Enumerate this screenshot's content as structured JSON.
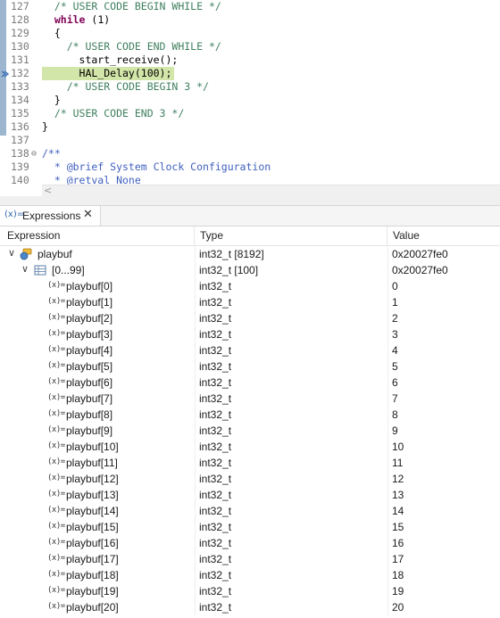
{
  "editor": {
    "lines": [
      {
        "num": "127",
        "parts": [
          {
            "t": "  ",
            "c": ""
          },
          {
            "t": "/* USER CODE BEGIN WHILE */",
            "c": "c-comment"
          }
        ]
      },
      {
        "num": "128",
        "parts": [
          {
            "t": "  ",
            "c": ""
          },
          {
            "t": "while",
            "c": "c-kw"
          },
          {
            "t": " (1)",
            "c": ""
          }
        ]
      },
      {
        "num": "129",
        "parts": [
          {
            "t": "  {",
            "c": ""
          }
        ]
      },
      {
        "num": "130",
        "parts": [
          {
            "t": "    ",
            "c": ""
          },
          {
            "t": "/* USER CODE END WHILE */",
            "c": "c-comment"
          }
        ]
      },
      {
        "num": "131",
        "parts": [
          {
            "t": "      start_receive();",
            "c": ""
          }
        ]
      },
      {
        "num": "132",
        "parts": [
          {
            "t": "      HAL_Delay(100);",
            "c": ""
          }
        ],
        "highlight": true,
        "exec": true
      },
      {
        "num": "133",
        "parts": [
          {
            "t": "    ",
            "c": ""
          },
          {
            "t": "/* USER CODE BEGIN 3 */",
            "c": "c-comment"
          }
        ]
      },
      {
        "num": "134",
        "parts": [
          {
            "t": "  }",
            "c": ""
          }
        ]
      },
      {
        "num": "135",
        "parts": [
          {
            "t": "  ",
            "c": ""
          },
          {
            "t": "/* USER CODE END 3 */",
            "c": "c-comment"
          }
        ]
      },
      {
        "num": "136",
        "parts": [
          {
            "t": "}",
            "c": ""
          }
        ]
      },
      {
        "num": "137",
        "parts": []
      },
      {
        "num": "138",
        "fold": "⊖",
        "parts": [
          {
            "t": "/**",
            "c": "c-doc"
          }
        ]
      },
      {
        "num": "139",
        "parts": [
          {
            "t": "  * @brief System Clock Configuration",
            "c": "c-doc"
          }
        ]
      },
      {
        "num": "140",
        "parts": [
          {
            "t": "  * @retval None",
            "c": "c-doc"
          }
        ]
      }
    ],
    "hscroll_arrow": "<"
  },
  "view": {
    "tab_icon": "(x)=",
    "tab_label": "Expressions",
    "close_glyph": "✕"
  },
  "columns": {
    "expression": "Expression",
    "type": "Type",
    "value": "Value"
  },
  "icons": {
    "variable": "(x)=",
    "twisty_expanded": "∨"
  },
  "tree": {
    "root": {
      "name": "playbuf",
      "type": "int32_t [8192]",
      "value": "0x20027fe0"
    },
    "group": {
      "name": "[0...99]",
      "type": "int32_t [100]",
      "value": "0x20027fe0"
    },
    "elements": [
      {
        "name": "playbuf[0]",
        "type": "int32_t",
        "value": "0"
      },
      {
        "name": "playbuf[1]",
        "type": "int32_t",
        "value": "1"
      },
      {
        "name": "playbuf[2]",
        "type": "int32_t",
        "value": "2"
      },
      {
        "name": "playbuf[3]",
        "type": "int32_t",
        "value": "3"
      },
      {
        "name": "playbuf[4]",
        "type": "int32_t",
        "value": "4"
      },
      {
        "name": "playbuf[5]",
        "type": "int32_t",
        "value": "5"
      },
      {
        "name": "playbuf[6]",
        "type": "int32_t",
        "value": "6"
      },
      {
        "name": "playbuf[7]",
        "type": "int32_t",
        "value": "7"
      },
      {
        "name": "playbuf[8]",
        "type": "int32_t",
        "value": "8"
      },
      {
        "name": "playbuf[9]",
        "type": "int32_t",
        "value": "9"
      },
      {
        "name": "playbuf[10]",
        "type": "int32_t",
        "value": "10"
      },
      {
        "name": "playbuf[11]",
        "type": "int32_t",
        "value": "11"
      },
      {
        "name": "playbuf[12]",
        "type": "int32_t",
        "value": "12"
      },
      {
        "name": "playbuf[13]",
        "type": "int32_t",
        "value": "13"
      },
      {
        "name": "playbuf[14]",
        "type": "int32_t",
        "value": "14"
      },
      {
        "name": "playbuf[15]",
        "type": "int32_t",
        "value": "15"
      },
      {
        "name": "playbuf[16]",
        "type": "int32_t",
        "value": "16"
      },
      {
        "name": "playbuf[17]",
        "type": "int32_t",
        "value": "17"
      },
      {
        "name": "playbuf[18]",
        "type": "int32_t",
        "value": "18"
      },
      {
        "name": "playbuf[19]",
        "type": "int32_t",
        "value": "19"
      },
      {
        "name": "playbuf[20]",
        "type": "int32_t",
        "value": "20"
      }
    ]
  },
  "colors": {
    "current_line_highlight": "#d3e6a9",
    "comment": "#3f7f5f",
    "keyword": "#7f0055",
    "javadoc": "#3f5fbf"
  }
}
